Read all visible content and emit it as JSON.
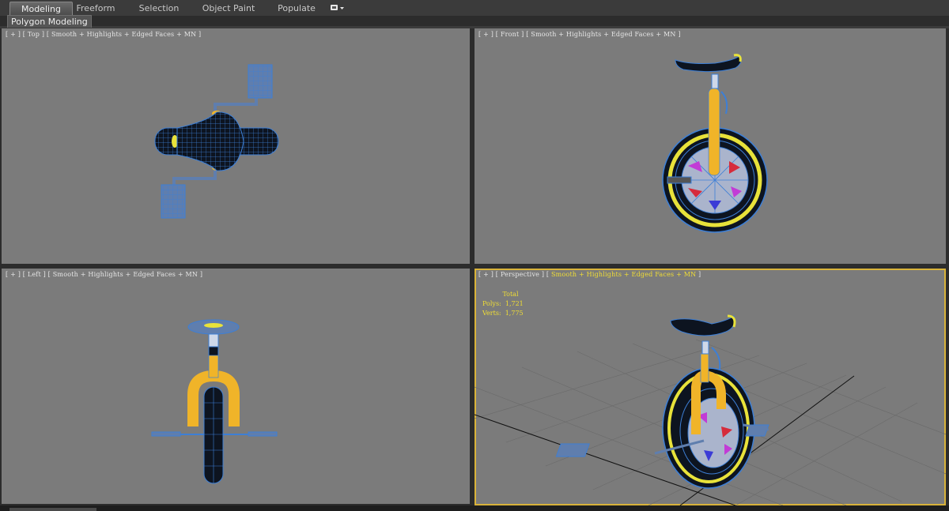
{
  "ribbon": {
    "tabs": [
      {
        "label": "Modeling",
        "active": true
      },
      {
        "label": "Freeform",
        "active": false
      },
      {
        "label": "Selection",
        "active": false
      },
      {
        "label": "Object Paint",
        "active": false
      },
      {
        "label": "Populate",
        "active": false
      }
    ],
    "dropdown_icon": "ribbon-options-icon",
    "panel_label": "Polygon Modeling"
  },
  "viewports": {
    "top": {
      "prefix": "[ + ] [ ",
      "name": "Top",
      "shading": "Smooth + Highlights + Edged Faces + MN"
    },
    "front": {
      "prefix": "[ + ] [ ",
      "name": "Front",
      "shading": "Smooth + Highlights + Edged Faces + MN"
    },
    "left": {
      "prefix": "[ + ] [ ",
      "name": "Left",
      "shading": "Smooth + Highlights + Edged Faces + MN"
    },
    "perspective": {
      "prefix": "[ + ] [ ",
      "name": "Perspective",
      "shading": "Smooth + Highlights + Edged Faces + MN",
      "active": true,
      "stats": {
        "header": "Total",
        "polys_label": "Polys:",
        "polys": "1,721",
        "verts_label": "Verts:",
        "verts": "1,775"
      }
    }
  },
  "colors": {
    "viewport_bg": "#7b7b7b",
    "wire": "#3d7fd6",
    "frame": "#f0b429",
    "tire": "#0d1420",
    "rim_yellow": "#e8e23a",
    "spoke_magenta": "#c23bd6",
    "spoke_blue": "#3b3bd6",
    "spoke_red": "#d62b3b",
    "pedal": "#5f7eae",
    "active_border": "#d9b33a"
  }
}
